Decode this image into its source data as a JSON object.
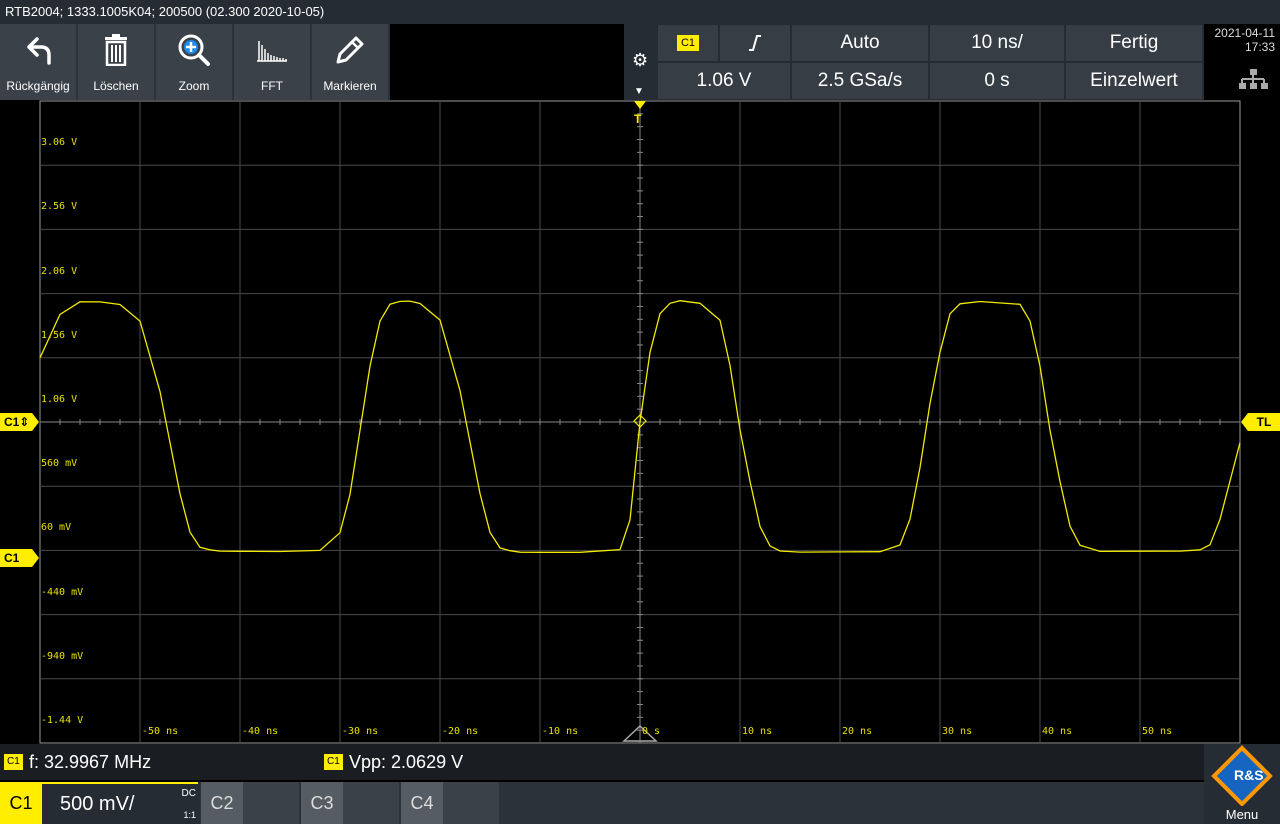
{
  "title": "RTB2004; 1333.1005K04; 200500 (02.300 2020-10-05)",
  "toolbar": {
    "undo": "Rückgängig",
    "delete": "Löschen",
    "zoom": "Zoom",
    "fft": "FFT",
    "mark": "Markieren"
  },
  "trigger": {
    "source": "C1",
    "slope_icon": "rising-edge-icon",
    "mode": "Auto",
    "timebase": "10 ns/",
    "status": "Fertig",
    "level": "1.06 V",
    "sample_rate": "2.5 GSa/s",
    "offset": "0 s",
    "acq_mode": "Einzelwert"
  },
  "datetime": {
    "date": "2021-04-11",
    "time": "17:33"
  },
  "grid": {
    "vlabels": [
      "3.06 V",
      "2.56 V",
      "2.06 V",
      "1.56 V",
      "1.06 V",
      "560 mV",
      "60 mV",
      "-440 mV",
      "-940 mV",
      "-1.44 V"
    ],
    "hlabels": [
      "-50 ns",
      "-40 ns",
      "-30 ns",
      "-20 ns",
      "-10 ns",
      "0 s",
      "10 ns",
      "20 ns",
      "30 ns",
      "40 ns",
      "50 ns"
    ]
  },
  "markers": {
    "c1_offset": "C1⇕",
    "c1_ground": "C1",
    "trigger_level": "TL",
    "trigger_pos": "T"
  },
  "chart_data": {
    "type": "line",
    "series": [
      {
        "values_note": "",
        "x": [
          -60,
          -58,
          -56,
          -54,
          -52,
          -50,
          -48,
          -47,
          -46,
          -45,
          -44,
          -43,
          -42,
          -40,
          -36,
          -32,
          -30,
          -29,
          -28,
          -27,
          -26,
          -25,
          -24,
          -23,
          -22,
          -20,
          -18,
          -17,
          -16,
          -15,
          -14,
          -13,
          -12,
          -10,
          -6,
          -2,
          -1,
          0,
          1,
          2,
          3,
          4,
          6,
          8,
          9,
          10,
          11,
          12,
          13,
          14,
          16,
          20,
          24,
          26,
          27,
          28,
          29,
          30,
          31,
          32,
          34,
          38,
          39,
          40,
          41,
          42,
          43,
          44,
          46,
          50,
          54,
          56,
          57,
          58,
          59,
          60
        ],
        "y": [
          1.56,
          1.9,
          2.0,
          2.0,
          1.98,
          1.85,
          1.3,
          0.9,
          0.5,
          0.2,
          0.08,
          0.06,
          0.05,
          0.05,
          0.05,
          0.06,
          0.2,
          0.5,
          1.0,
          1.5,
          1.85,
          1.98,
          2.0,
          2.0,
          1.98,
          1.85,
          1.3,
          0.9,
          0.5,
          0.2,
          0.08,
          0.06,
          0.05,
          0.05,
          0.05,
          0.07,
          0.3,
          1.06,
          1.6,
          1.9,
          1.98,
          2.0,
          1.98,
          1.85,
          1.5,
          1.0,
          0.6,
          0.25,
          0.1,
          0.06,
          0.05,
          0.05,
          0.05,
          0.1,
          0.3,
          0.7,
          1.2,
          1.6,
          1.9,
          1.98,
          2.0,
          1.98,
          1.85,
          1.5,
          1.0,
          0.6,
          0.25,
          0.1,
          0.05,
          0.05,
          0.05,
          0.06,
          0.1,
          0.3,
          0.6,
          0.9
        ]
      }
    ],
    "xlim": [
      -60,
      60
    ],
    "ylim": [
      -1.44,
      3.56
    ]
  },
  "measurements": {
    "freq_tag": "C1",
    "freq": "f: 32.9967 MHz",
    "vpp_tag": "C1",
    "vpp": "Vpp: 2.0629 V"
  },
  "channels": {
    "c1": "C1",
    "c1_scale": "500 mV/",
    "c1_coupling": "DC",
    "c1_ratio": "1:1",
    "c2": "C2",
    "c3": "C3",
    "c4": "C4"
  },
  "logo": {
    "menu": "Menu",
    "brand": "R&S"
  },
  "colors": {
    "trace": "#f2ea00",
    "accent": "#ffee00",
    "grid": "#444",
    "panel": "#2c3239"
  }
}
